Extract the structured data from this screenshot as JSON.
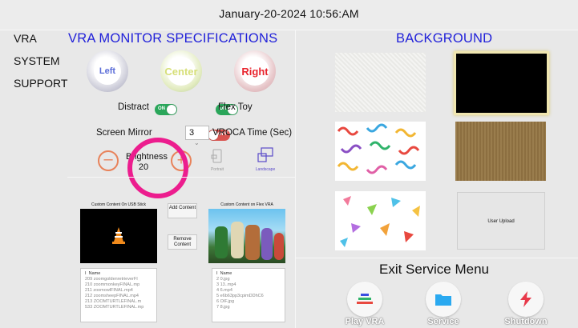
{
  "header": {
    "datetime": "January-20-2024   10:56:AM"
  },
  "sidebar": {
    "items": [
      "VRA",
      "SYSTEM",
      "SUPPORT"
    ]
  },
  "left_panel": {
    "title": "VRA MONITOR SPECIFICATIONS",
    "orbs": [
      {
        "label": "Left",
        "color": "#5b6dd8"
      },
      {
        "label": "Center",
        "color": "#e0e87e"
      },
      {
        "label": "Right",
        "color": "#e8252e"
      }
    ],
    "distract_label": "Distract",
    "distract_toggle": "ON",
    "flex_toy_toggle": "ON",
    "flex_toy_label": "Flex Toy",
    "screen_mirror_label": "Screen Mirror",
    "screen_mirror_toggle": "OFF",
    "vroca_value": "3",
    "vroca_label": "VROCA Time (Sec)",
    "brightness_label": "Brightness",
    "brightness_value": "20",
    "portrait_label": "Portrait",
    "landscape_label": "Landscape",
    "usb_title": "Custom Content On USB Stick",
    "flex_title": "Custom Content on Flex VRA",
    "add_content": "Add Content",
    "remove_content": "Remove Content",
    "usb_list": {
      "header": [
        "I",
        "Name"
      ],
      "rows": [
        [
          "209",
          "zoomgoldenretrieverFI"
        ],
        [
          "210",
          "zoommonkeyFINAL.mp"
        ],
        [
          "211",
          "zoomowlFINAL.mp4"
        ],
        [
          "212",
          "zoomsheepFINAL.mp4"
        ],
        [
          "213",
          "ZOOMTURTLEFINAL.m"
        ],
        [
          "533",
          "ZOOMTURTLEFINAL.mp"
        ]
      ]
    },
    "flex_list": {
      "header": [
        "I",
        "Name"
      ],
      "rows": [
        [
          "2",
          "0.jpg"
        ],
        [
          "3",
          "13..mp4"
        ],
        [
          "4",
          "6.mp4"
        ],
        [
          "5",
          "e6b63pp3cpimDDhC6"
        ],
        [
          "6",
          "OIF.jpg"
        ],
        [
          "7",
          "8.jpg"
        ]
      ]
    }
  },
  "right_panel": {
    "title": "BACKGROUND",
    "user_upload": "User Upload",
    "exit_label": "Exit Service Menu",
    "dock": [
      {
        "label": "Play VRA",
        "icon": "play-vra-icon"
      },
      {
        "label": "Service",
        "icon": "folder-icon"
      },
      {
        "label": "Shutdown",
        "icon": "shutdown-icon"
      }
    ]
  },
  "colors": {
    "accent_blue": "#1f1fd9",
    "highlight_circle": "#ec1d8e",
    "toggle_on": "#2aa65a",
    "toggle_off": "#d9534f"
  }
}
